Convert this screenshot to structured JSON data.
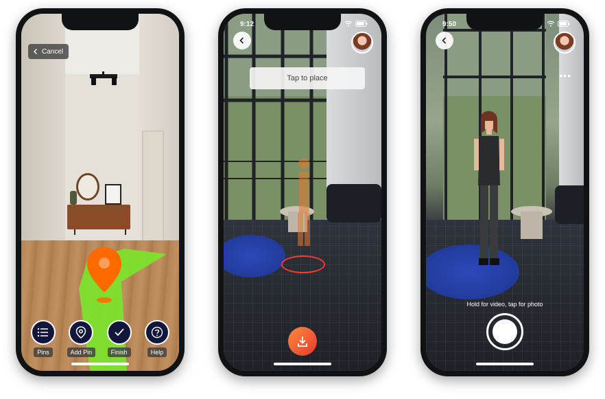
{
  "phones": [
    {
      "id": "pin-placement",
      "cancel_label": "Cancel",
      "toolbar": [
        {
          "label": "Pins",
          "icon": "list-icon"
        },
        {
          "label": "Add Pin",
          "icon": "map-pin-icon"
        },
        {
          "label": "Finish",
          "icon": "check-icon"
        },
        {
          "label": "Help",
          "icon": "question-icon"
        }
      ],
      "colors": {
        "arrow": "#7de22b",
        "pin": "#ff6a00",
        "toolbar_circle": "#12163a"
      }
    },
    {
      "id": "ar-placement",
      "status_time": "9:12",
      "tap_banner": "Tap to place",
      "icons": [
        "back-icon",
        "avatar",
        "download-icon"
      ],
      "colors": {
        "place_button_start": "#ff8a3d",
        "place_button_end": "#e63a2e",
        "ring": "#ff3b30"
      }
    },
    {
      "id": "ar-capture",
      "status_time": "9:50",
      "more_icon": "•••",
      "hint": "Hold for video, tap for photo",
      "icons": [
        "back-icon",
        "avatar",
        "more-icon",
        "shutter-button"
      ]
    }
  ]
}
